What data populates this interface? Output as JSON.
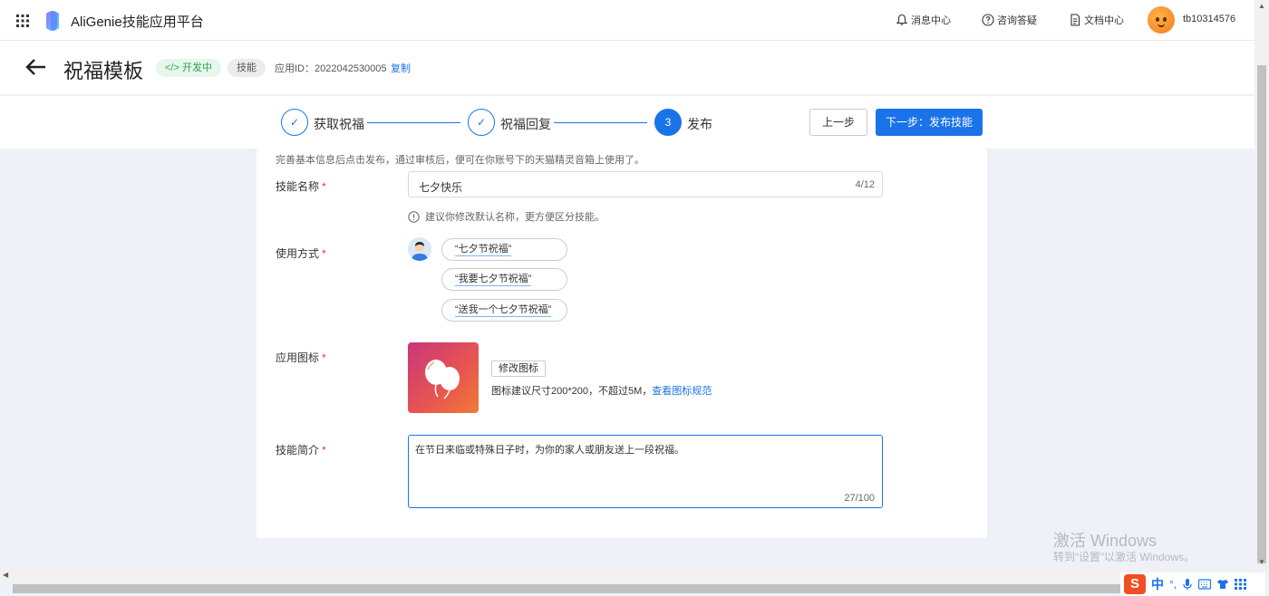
{
  "topnav": {
    "brand": "AliGenie技能应用平台",
    "links": [
      {
        "label": "消息中心",
        "icon": "bell-icon"
      },
      {
        "label": "咨询答疑",
        "icon": "question-circle-icon"
      },
      {
        "label": "文档中心",
        "icon": "document-icon"
      }
    ],
    "username": "tb10314576"
  },
  "titlebar": {
    "title": "祝福模板",
    "status": "开发中",
    "tag": "技能",
    "app_id": "应用ID：2022042530005",
    "copy_label": "复制"
  },
  "steps": {
    "items": [
      {
        "index": "1",
        "label": "获取祝福",
        "state": "done"
      },
      {
        "index": "2",
        "label": "祝福回复",
        "state": "done"
      },
      {
        "index": "3",
        "label": "发布",
        "state": "active"
      }
    ],
    "prev_label": "上一步",
    "next_label": "下一步：发布技能"
  },
  "form": {
    "hint": "完善基本信息后点击发布，通过审核后，便可在你账号下的天猫精灵音箱上使用了。",
    "name_label": "技能名称",
    "name_value": "七夕快乐",
    "name_count": "4/12",
    "name_advice": "建议你修改默认名称，更方便区分技能。",
    "usage_label": "使用方式",
    "usage_phrases": [
      "“七夕节祝福”",
      "“我要七夕节祝福”",
      "“送我一个七夕节祝福”"
    ],
    "icon_label": "应用图标",
    "modify_icon_label": "修改图标",
    "icon_hint": "图标建议尺寸200*200，不超过5M，",
    "icon_spec_link": "查看图标规范",
    "intro_label": "技能简介",
    "intro_value": "在节日来临或特殊日子时，为你的家人或朋友送上一段祝福。",
    "intro_count": "27/100",
    "required_mark": "*"
  },
  "watermark": {
    "line1": "激活 Windows",
    "line2": "转到“设置”以激活 Windows。"
  },
  "ime": {
    "logo": "S",
    "mode": "中"
  },
  "colors": {
    "accent": "#1a73e8",
    "status_green": "#2ea44f",
    "required": "#e53935"
  }
}
